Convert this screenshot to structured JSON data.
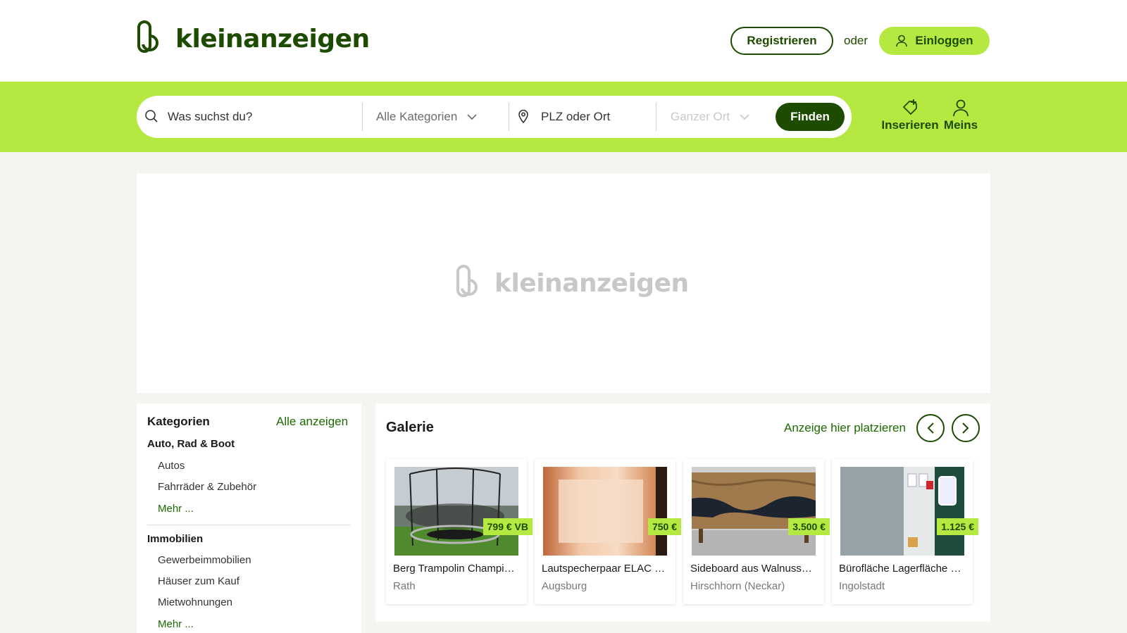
{
  "header": {
    "logo_text": "kleinanzeigen",
    "register_label": "Registrieren",
    "or_label": "oder",
    "login_label": "Einloggen"
  },
  "search": {
    "query_placeholder": "Was suchst du?",
    "category_value": "Alle Kategorien",
    "location_placeholder": "PLZ oder Ort",
    "radius_value": "Ganzer Ort",
    "find_label": "Finden",
    "post_label": "Inserieren",
    "mine_label": "Meins"
  },
  "banner": {
    "logo_text": "kleinanzeigen"
  },
  "categories": {
    "title": "Kategorien",
    "all_label": "Alle anzeigen",
    "groups": [
      {
        "name": "Auto, Rad & Boot",
        "items": [
          "Autos",
          "Fahrräder & Zubehör"
        ],
        "more": "Mehr ..."
      },
      {
        "name": "Immobilien",
        "items": [
          "Gewerbeimmobilien",
          "Häuser zum Kauf",
          "Mietwohnungen"
        ],
        "more": "Mehr ..."
      }
    ]
  },
  "gallery": {
    "title": "Galerie",
    "place_ad_label": "Anzeige hier platzieren",
    "items": [
      {
        "title": "Berg Trampolin Champi…",
        "price": "799 € VB",
        "location": "Rath"
      },
      {
        "title": "Lautspecherpaar ELAC …",
        "price": "750 €",
        "location": "Augsburg"
      },
      {
        "title": "Sideboard aus Walnuss…",
        "price": "3.500 €",
        "location": "Hirschhorn (Neckar)"
      },
      {
        "title": "Bürofläche Lagerfläche …",
        "price": "1.125 €",
        "location": "Ingolstadt"
      }
    ]
  },
  "colors": {
    "brand_green": "#1d4b00",
    "lime": "#b5e941",
    "link_green": "#1d6b00"
  }
}
